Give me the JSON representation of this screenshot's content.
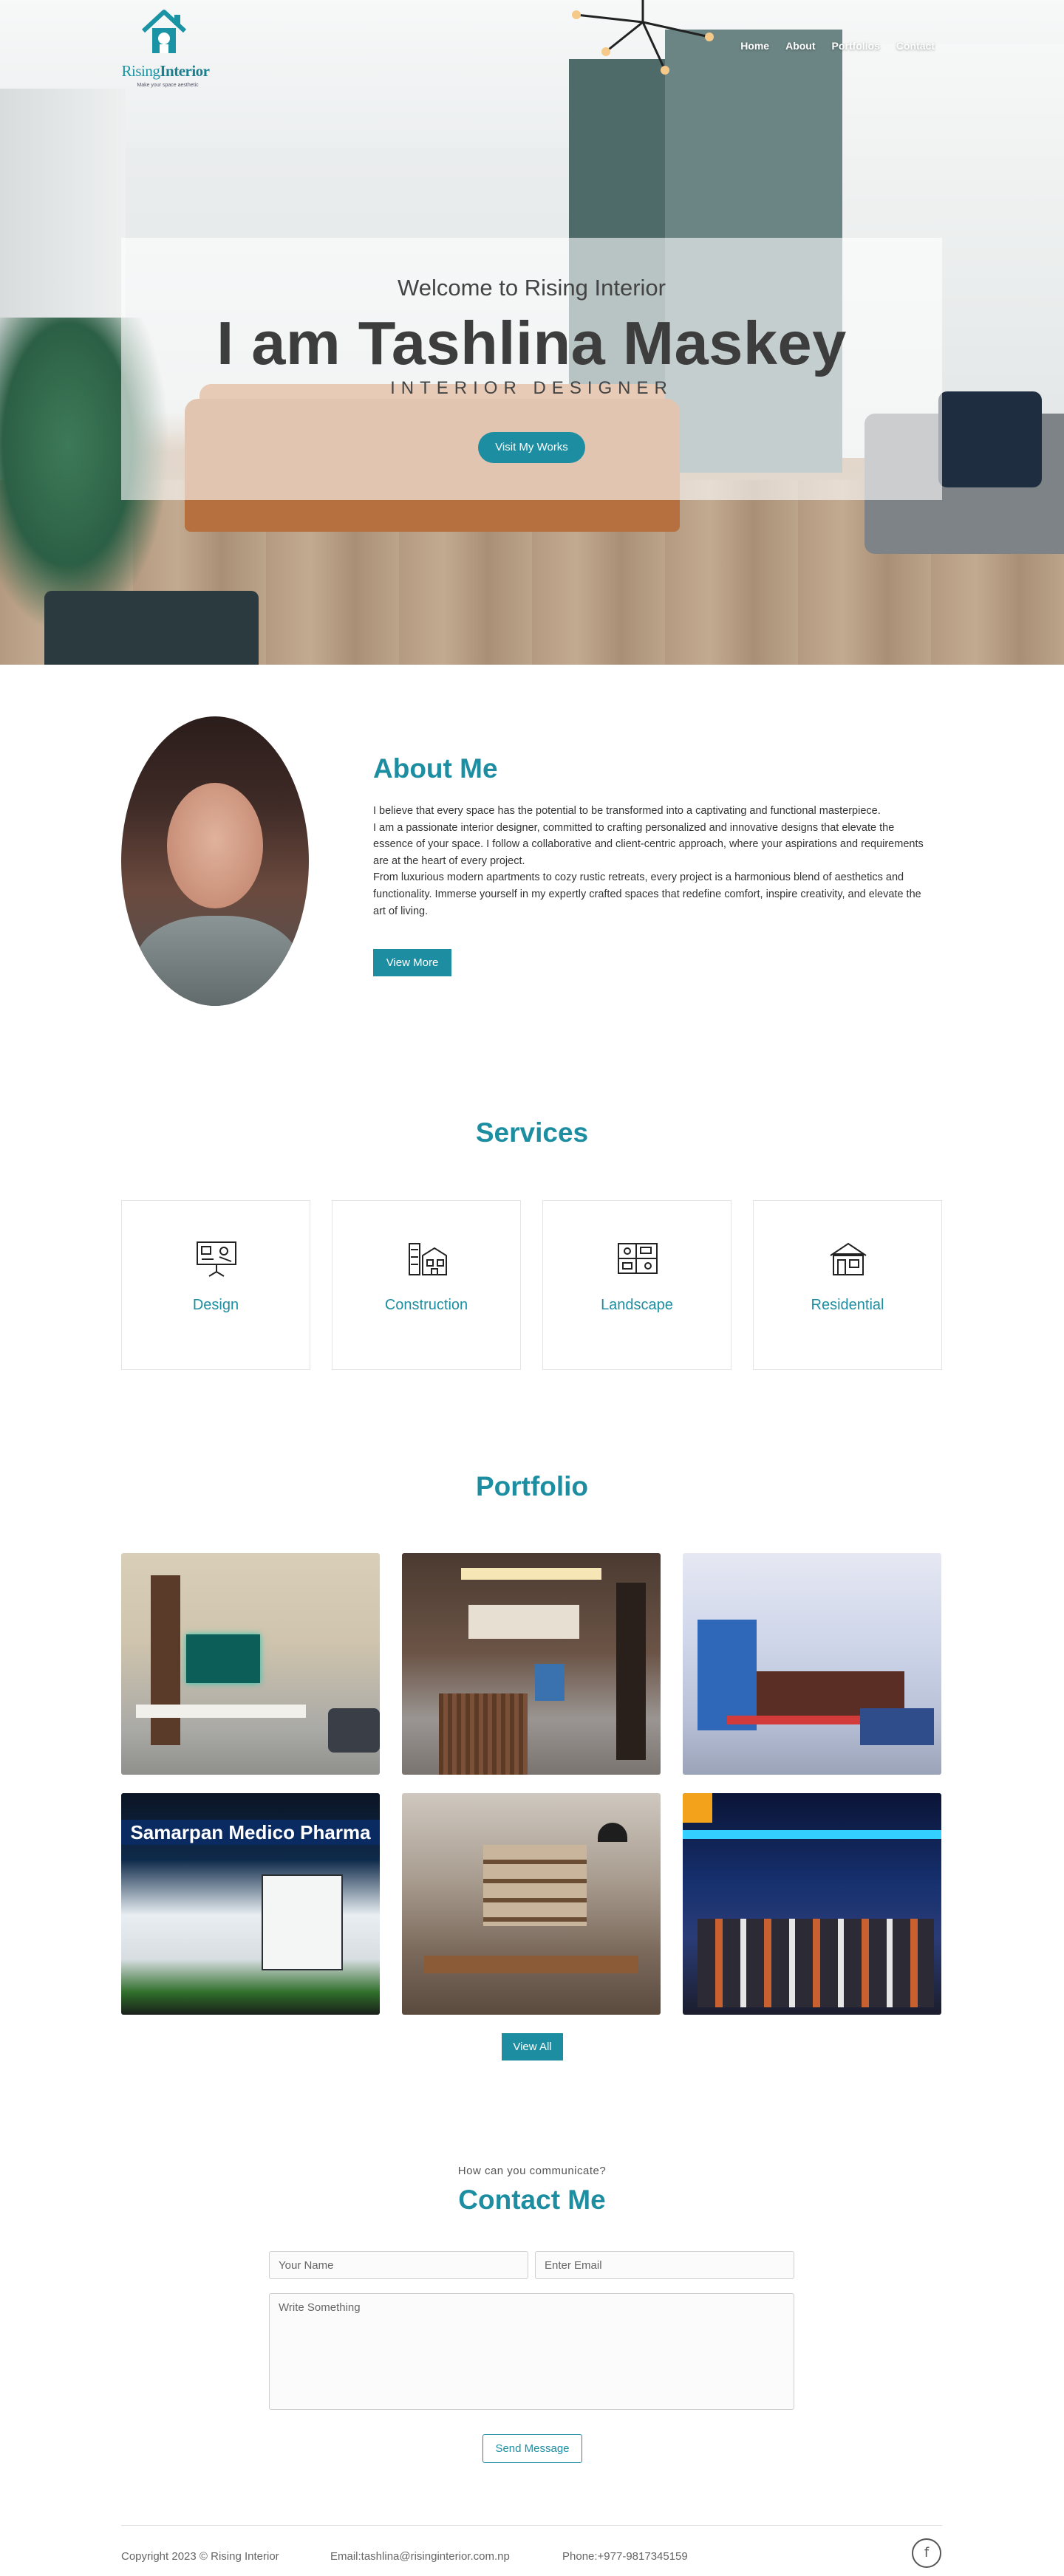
{
  "brand": {
    "name_part1": "Rising",
    "name_part2": "Interior",
    "tagline": "Make your space aesthetic"
  },
  "nav": {
    "items": [
      {
        "label": "Home"
      },
      {
        "label": "About"
      },
      {
        "label": "Portfolios"
      },
      {
        "label": "Contact"
      }
    ]
  },
  "hero": {
    "welcome": "Welcome to Rising Interior",
    "name": "I am Tashlina Maskey",
    "role": "INTERIOR DESIGNER",
    "button": "Visit My Works"
  },
  "about": {
    "title": "About Me",
    "paragraphs": [
      "I believe that every space has the potential to be transformed into a captivating and functional masterpiece.",
      "I am a passionate interior designer, committed to crafting personalized and innovative designs that elevate the essence of your space. I follow a collaborative and client-centric approach, where your aspirations and requirements are at the heart of every project.",
      "From luxurious modern apartments to cozy rustic retreats, every project is a harmonious blend of aesthetics and functionality. Immerse yourself in my expertly crafted spaces that redefine comfort, inspire creativity, and elevate the art of living."
    ],
    "button": "View More"
  },
  "services": {
    "title": "Services",
    "items": [
      {
        "label": "Design",
        "icon": "design-board-icon"
      },
      {
        "label": "Construction",
        "icon": "construction-icon"
      },
      {
        "label": "Landscape",
        "icon": "landscape-plan-icon"
      },
      {
        "label": "Residential",
        "icon": "house-icon"
      }
    ]
  },
  "portfolio": {
    "title": "Portfolio",
    "sign_text": "Samarpan Medico Pharma",
    "button": "View All"
  },
  "contact": {
    "subtitle": "How can you communicate?",
    "title": "Contact Me",
    "name_placeholder": "Your Name",
    "email_placeholder": "Enter Email",
    "message_placeholder": "Write Something",
    "button": "Send Message"
  },
  "footer": {
    "copyright": "Copyright 2023 © Rising Interior",
    "email": "Email:tashlina@risinginterior.com.np",
    "phone": "Phone:+977-9817345159",
    "social_icon": "facebook-icon"
  },
  "colors": {
    "accent": "#1d8ea1",
    "heading": "#3d3d3d"
  }
}
